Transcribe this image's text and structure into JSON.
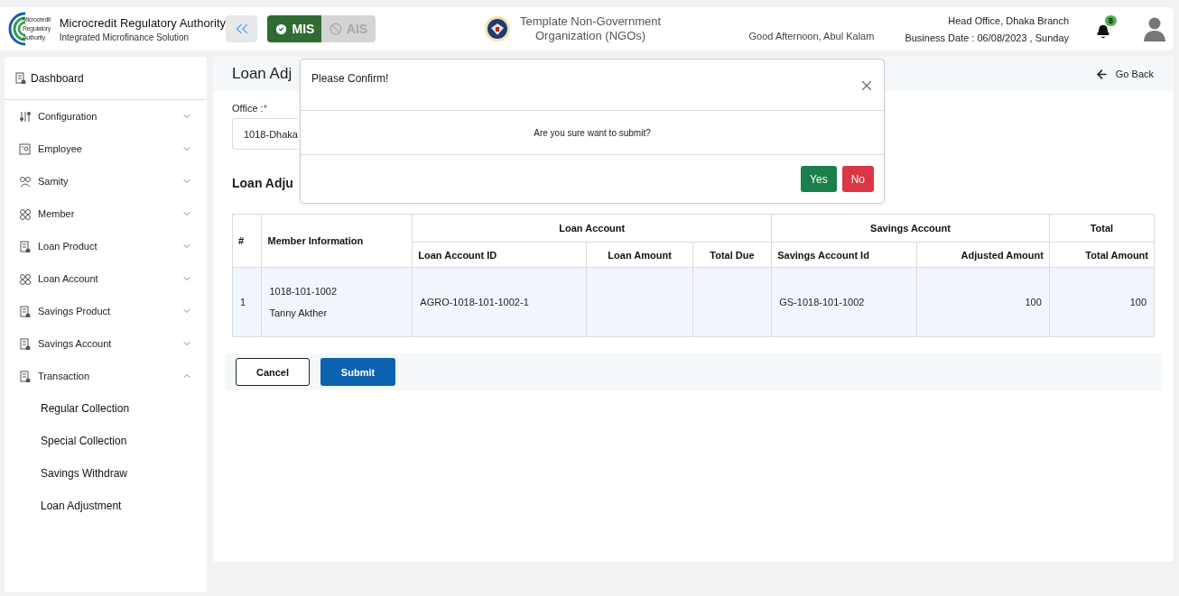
{
  "header": {
    "logo_lines": [
      "Microcredit",
      "Regulatory",
      "Authority"
    ],
    "org_name": "Microcredit Regulatory Authority",
    "org_subtitle": "Integrated Microfinance Solution",
    "modules": [
      {
        "label": "MIS",
        "selected": true
      },
      {
        "label": "AIS",
        "selected": false
      }
    ],
    "ngo_lines": [
      "Template Non-Government",
      "Organization (NGOs)"
    ],
    "greeting": "Good Afternoon, Abul Kalam",
    "branch": "Head Office, Dhaka Branch",
    "business_date": "Business Date : 06/08/2023 , Sunday",
    "notification_count": "8"
  },
  "sidebar": {
    "items": [
      {
        "label": "Dashboard",
        "kind": "link"
      },
      {
        "label": "Configuration",
        "kind": "menu",
        "expanded": false
      },
      {
        "label": "Employee",
        "kind": "menu",
        "expanded": false
      },
      {
        "label": "Samity",
        "kind": "menu",
        "expanded": false
      },
      {
        "label": "Member",
        "kind": "menu",
        "expanded": false
      },
      {
        "label": "Loan Product",
        "kind": "menu",
        "expanded": false
      },
      {
        "label": "Loan Account",
        "kind": "menu",
        "expanded": false
      },
      {
        "label": "Savings Product",
        "kind": "menu",
        "expanded": false
      },
      {
        "label": "Savings Account",
        "kind": "menu",
        "expanded": false
      },
      {
        "label": "Transaction",
        "kind": "menu",
        "expanded": true,
        "children": [
          {
            "label": "Regular Collection"
          },
          {
            "label": "Special Collection"
          },
          {
            "label": "Savings Withdraw"
          },
          {
            "label": "Loan Adjustment"
          }
        ]
      }
    ]
  },
  "page": {
    "title": "Loan Adj",
    "go_back": "Go Back",
    "office_label": "Office :",
    "required_mark": "*",
    "office_value": "1018-Dhaka",
    "section_title": "Loan Adju",
    "table": {
      "lead_columns": [
        "#",
        "Member Information"
      ],
      "groups": [
        {
          "label": "Loan Account",
          "columns": [
            "Loan Account ID",
            "Loan Amount",
            "Total Due"
          ]
        },
        {
          "label": "Savings Account",
          "columns": [
            "Savings Account Id",
            "Adjusted Amount"
          ]
        },
        {
          "label": "Total",
          "columns": [
            "Total Amount"
          ]
        }
      ],
      "rows": [
        {
          "number": "1",
          "member_id": "1018-101-1002",
          "member_name": "Tanny Akther",
          "cells": [
            "AGRO-1018-101-1002-1",
            null,
            null,
            "GS-1018-101-1002",
            "100",
            "100"
          ]
        }
      ]
    },
    "buttons": [
      {
        "label": "Cancel",
        "kind": "outline"
      },
      {
        "label": "Submit",
        "kind": "primary"
      }
    ]
  },
  "modal": {
    "title": "Please Confirm!",
    "message": "Are you sure want to submit?",
    "buttons": [
      {
        "label": "Yes",
        "kind": "confirm"
      },
      {
        "label": "No",
        "kind": "cancel"
      }
    ]
  }
}
